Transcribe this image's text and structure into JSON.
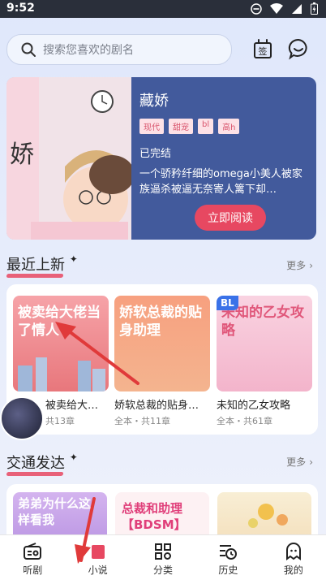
{
  "status_bar": {
    "time": "9:52"
  },
  "search": {
    "placeholder": "搜索您喜欢的剧名"
  },
  "top_icons": {
    "left": "checkin-icon",
    "right": "chat-icon",
    "checkin_label": "签"
  },
  "banner": {
    "title": "藏娇",
    "tags": [
      "现代",
      "甜宠",
      "bl",
      "高h"
    ],
    "status": "已完结",
    "description": "一个骄矜纤细的omega小美人被家族逼杀被逼无奈寄人篱下却…",
    "button": "立即阅读",
    "art_text": "娇",
    "slides": 6,
    "active_slide": 6
  },
  "section1": {
    "title": "最近上新",
    "more": "更多",
    "books": [
      {
        "title": "被卖给大佬当了…",
        "meta": "共13章",
        "cover_text": "被卖给大佬当了情人",
        "cover_color": "#f08a8f"
      },
      {
        "title": "娇软总裁的贴身…",
        "meta": "全本・共11章",
        "cover_text": "娇软总裁的贴身助理",
        "cover_color": "#f49079"
      },
      {
        "title": "未知的乙女攻略",
        "meta": "全本・共61章",
        "cover_text": "未知的乙女攻略",
        "cover_color": "#f7c4d8",
        "badge": "BL"
      }
    ]
  },
  "section2": {
    "title": "交通发达",
    "more": "更多",
    "covers": [
      {
        "text": "弟弟为什么这样看我",
        "color": "#c9a7e8"
      },
      {
        "text": "总裁和助理【BDSM】",
        "color": "#fdf1f3"
      },
      {
        "text": "",
        "color": "#f6e9c9"
      }
    ]
  },
  "nav": [
    {
      "label": "听剧",
      "icon": "radio-icon"
    },
    {
      "label": "小说",
      "icon": "book-icon"
    },
    {
      "label": "分类",
      "icon": "category-icon"
    },
    {
      "label": "历史",
      "icon": "history-icon"
    },
    {
      "label": "我的",
      "icon": "profile-icon"
    }
  ]
}
